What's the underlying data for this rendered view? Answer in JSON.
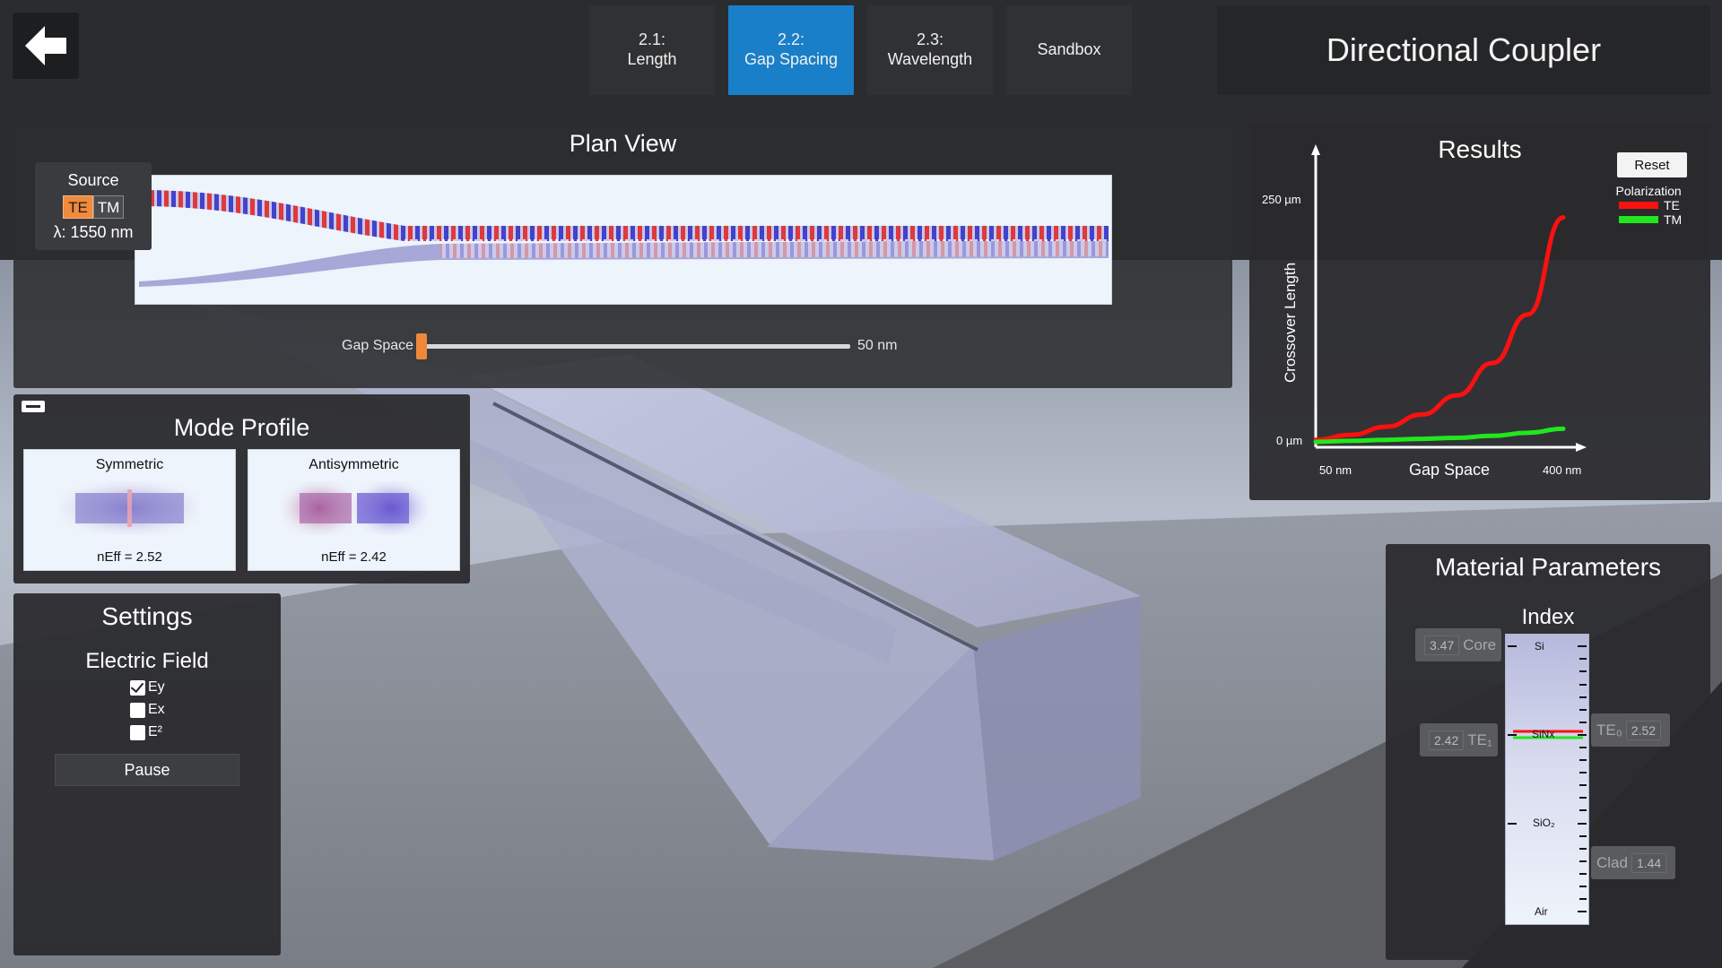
{
  "nav": {
    "back_label": "back",
    "tabs": [
      {
        "line1": "2.1:",
        "line2": "Length"
      },
      {
        "line1": "2.2:",
        "line2": "Gap Spacing"
      },
      {
        "line1": "2.3:",
        "line2": "Wavelength"
      },
      {
        "line1": "Sandbox",
        "line2": ""
      }
    ],
    "active_tab": 1
  },
  "app_title": "Directional Coupler",
  "plan_view": {
    "title": "Plan View",
    "source": {
      "label": "Source",
      "pol_te": "TE",
      "pol_tm": "TM",
      "selected": "TE",
      "wavelength": "λ: 1550 nm"
    },
    "slider": {
      "label": "Gap Space",
      "value_label": "50 nm",
      "fraction": 0.0
    }
  },
  "mode_profile": {
    "title": "Mode Profile",
    "symmetric": {
      "label": "Symmetric",
      "neff": "nEff = 2.52"
    },
    "antisymmetric": {
      "label": "Antisymmetric",
      "neff": "nEff = 2.42"
    }
  },
  "settings": {
    "title": "Settings",
    "field_title": "Electric Field",
    "options": [
      {
        "label": "Ey",
        "checked": true
      },
      {
        "label": "Ex",
        "checked": false
      },
      {
        "label": "E²",
        "checked": false
      }
    ],
    "pause_label": "Pause"
  },
  "results": {
    "title": "Results",
    "reset_label": "Reset",
    "legend_title": "Polarization",
    "te_label": "TE",
    "tm_label": "TM",
    "te_color": "#ff1010",
    "tm_color": "#22e61e"
  },
  "chart_data": {
    "type": "line",
    "xlabel": "Gap Space",
    "ylabel": "Crossover Length",
    "x_tick_labels": [
      "50 nm",
      "400 nm"
    ],
    "y_tick_labels": [
      "0 µm",
      "250 µm"
    ],
    "xlim": [
      50,
      400
    ],
    "ylim": [
      0,
      250
    ],
    "series": [
      {
        "name": "TE",
        "color": "#ff1010",
        "x": [
          50,
          100,
          150,
          200,
          250,
          300,
          350,
          400
        ],
        "y": [
          2,
          7,
          15,
          27,
          46,
          78,
          126,
          222
        ]
      },
      {
        "name": "TM",
        "color": "#22e61e",
        "x": [
          50,
          100,
          150,
          200,
          250,
          300,
          350,
          400
        ],
        "y": [
          0,
          1,
          2,
          3,
          4,
          6,
          9,
          13
        ]
      }
    ]
  },
  "material": {
    "title": "Material Parameters",
    "index_title": "Index",
    "levels": [
      "Si",
      "SiNx",
      "SiO₂",
      "Air"
    ],
    "core": {
      "value": "3.47",
      "label": "Core"
    },
    "te1": {
      "value": "2.42",
      "label": "TE₁"
    },
    "te0": {
      "value": "2.52",
      "label": "TE₀"
    },
    "clad": {
      "value": "1.44",
      "label": "Clad"
    }
  }
}
